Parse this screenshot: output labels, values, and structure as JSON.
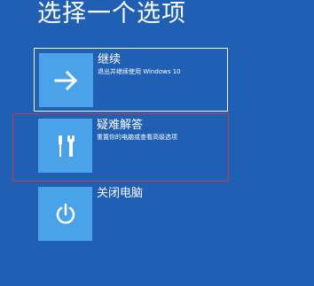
{
  "title": "选择一个选项",
  "options": [
    {
      "label": "继续",
      "description": "退出并继续使用 Windows 10",
      "icon": "arrow-right-icon"
    },
    {
      "label": "疑难解答",
      "description": "重置你的电脑或查看高级选项",
      "icon": "tools-icon"
    },
    {
      "label": "关闭电脑",
      "description": "",
      "icon": "power-icon"
    }
  ],
  "colors": {
    "background": "#1f5fb4",
    "tile": "#4aa3e8",
    "highlight": "#c0394b"
  }
}
